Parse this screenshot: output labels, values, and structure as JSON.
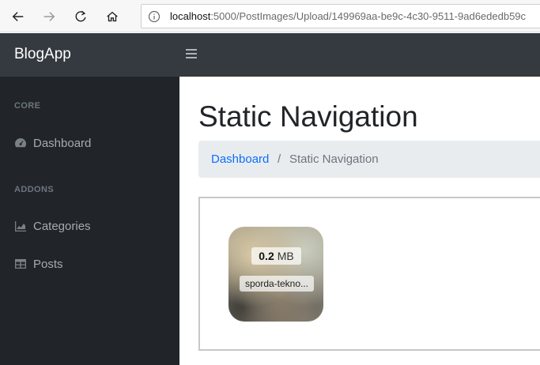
{
  "browser": {
    "url_host": "localhost",
    "url_rest": ":5000/PostImages/Upload/149969aa-be9c-4c30-9511-9ad6ededb59c"
  },
  "app": {
    "brand": "BlogApp"
  },
  "sidebar": {
    "headings": [
      "CORE",
      "ADDONS"
    ],
    "items": [
      {
        "label": "Dashboard",
        "icon": "dashboard-gauge-icon"
      },
      {
        "label": "Categories",
        "icon": "area-chart-icon"
      },
      {
        "label": "Posts",
        "icon": "table-icon"
      }
    ]
  },
  "main": {
    "title": "Static Navigation",
    "breadcrumb": {
      "link": "Dashboard",
      "separator": "/",
      "active": "Static Navigation"
    },
    "upload": {
      "size_value": "0.2",
      "size_unit": "MB",
      "filename": "sporda-tekno..."
    }
  },
  "colors": {
    "topbar": "#343a40",
    "sidebar": "#212529",
    "link": "#0d6efd"
  }
}
